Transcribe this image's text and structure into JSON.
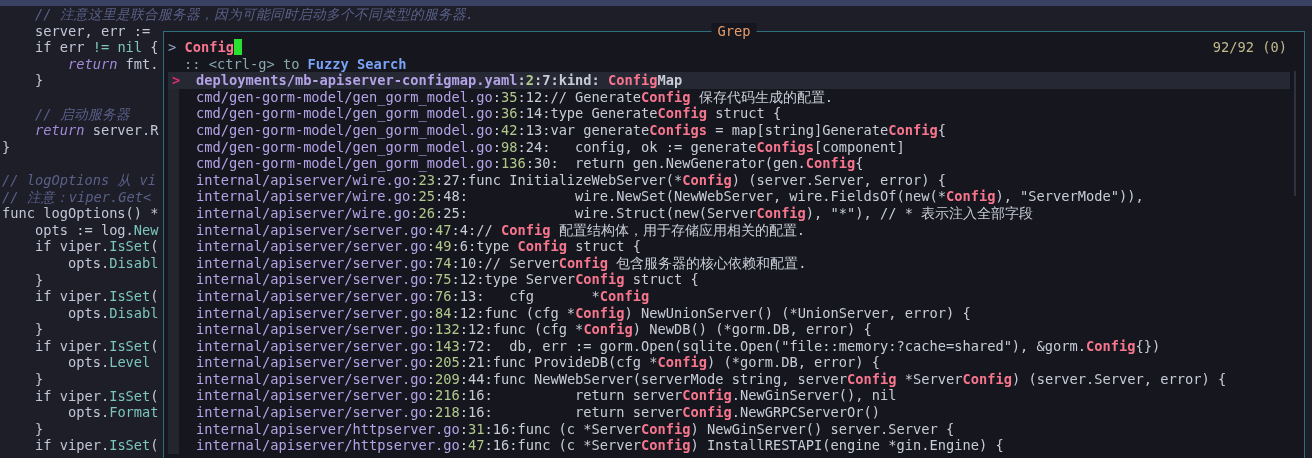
{
  "editor": {
    "code_blocks": [
      [
        {
          "segments": [
            {
              "kind": "comment",
              "text": "    // 注意这里是联合服务器，因为可能同时启动多个不同类型的服务器."
            }
          ]
        },
        {
          "segments": [
            {
              "kind": "text",
              "text": "    server, err :="
            }
          ]
        },
        {
          "segments": [
            {
              "kind": "text",
              "text": "    if err "
            },
            {
              "kind": "member",
              "text": "!= nil"
            },
            {
              "kind": "text",
              "text": " {"
            }
          ]
        },
        {
          "segments": [
            {
              "kind": "keyword",
              "text": "        return"
            },
            {
              "kind": "text",
              "text": " fmt."
            }
          ]
        },
        {
          "segments": [
            {
              "kind": "text",
              "text": "    }"
            }
          ]
        }
      ],
      [
        {
          "segments": [
            {
              "kind": "comment",
              "text": "    // 启动服务器"
            }
          ]
        },
        {
          "segments": [
            {
              "kind": "keyword",
              "text": "    return"
            },
            {
              "kind": "text",
              "text": " server.R"
            }
          ]
        },
        {
          "segments": [
            {
              "kind": "text",
              "text": "}"
            }
          ]
        }
      ],
      [
        {
          "segments": [
            {
              "kind": "comment",
              "text": "// logOptions 从 vi"
            }
          ]
        },
        {
          "segments": [
            {
              "kind": "comment",
              "text": "// 注意：viper.Get<"
            }
          ]
        },
        {
          "segments": [
            {
              "kind": "text",
              "text": "func logOptions() *"
            }
          ]
        },
        {
          "segments": [
            {
              "kind": "text",
              "text": "    opts := log."
            },
            {
              "kind": "member",
              "text": "New"
            }
          ]
        },
        {
          "segments": [
            {
              "kind": "text",
              "text": "    if viper."
            },
            {
              "kind": "member",
              "text": "IsSet"
            },
            {
              "kind": "text",
              "text": "("
            }
          ]
        },
        {
          "segments": [
            {
              "kind": "text",
              "text": "        opts."
            },
            {
              "kind": "member",
              "text": "Disabl"
            }
          ]
        },
        {
          "segments": [
            {
              "kind": "text",
              "text": "    }"
            }
          ]
        },
        {
          "segments": [
            {
              "kind": "text",
              "text": "    if viper."
            },
            {
              "kind": "member",
              "text": "IsSet"
            },
            {
              "kind": "text",
              "text": "("
            }
          ]
        },
        {
          "segments": [
            {
              "kind": "text",
              "text": "        opts."
            },
            {
              "kind": "member",
              "text": "Disabl"
            }
          ]
        },
        {
          "segments": [
            {
              "kind": "text",
              "text": "    }"
            }
          ]
        },
        {
          "segments": [
            {
              "kind": "text",
              "text": "    if viper."
            },
            {
              "kind": "member",
              "text": "IsSet"
            },
            {
              "kind": "text",
              "text": "("
            }
          ]
        },
        {
          "segments": [
            {
              "kind": "text",
              "text": "        opts."
            },
            {
              "kind": "member",
              "text": "Level"
            }
          ]
        },
        {
          "segments": [
            {
              "kind": "text",
              "text": "    }"
            }
          ]
        },
        {
          "segments": [
            {
              "kind": "text",
              "text": "    if viper."
            },
            {
              "kind": "member",
              "text": "IsSet"
            },
            {
              "kind": "text",
              "text": "("
            }
          ]
        },
        {
          "segments": [
            {
              "kind": "text",
              "text": "        opts."
            },
            {
              "kind": "member",
              "text": "Format"
            }
          ]
        },
        {
          "segments": [
            {
              "kind": "text",
              "text": "    }"
            }
          ]
        },
        {
          "segments": [
            {
              "kind": "text",
              "text": "    if viper."
            },
            {
              "kind": "member",
              "text": "IsSet"
            },
            {
              "kind": "text",
              "text": "("
            }
          ]
        }
      ]
    ]
  },
  "popup": {
    "title": "Grep",
    "prompt": {
      "symbol": ">",
      "query": "Config"
    },
    "counter": "92/92 (0)",
    "hint": ":: <ctrl-g> to **Fuzzy Search**",
    "selection_marker": ">",
    "results": [
      {
        "selected": true,
        "location": "deployments/mb-apiserver-configmap.yaml:2:7:",
        "segments": [
          {
            "text": "kind: ",
            "match": false
          },
          {
            "text": "Config",
            "match": true
          },
          {
            "text": "Map",
            "match": false
          }
        ]
      },
      {
        "selected": false,
        "location": "cmd/gen-gorm-model/gen_gorm_model.go:35:12:",
        "segments": [
          {
            "text": "// Generate",
            "match": false
          },
          {
            "text": "Config",
            "match": true
          },
          {
            "text": " 保存代码生成的配置.",
            "match": false
          }
        ]
      },
      {
        "selected": false,
        "location": "cmd/gen-gorm-model/gen_gorm_model.go:36:14:",
        "segments": [
          {
            "text": "type Generate",
            "match": false
          },
          {
            "text": "Config",
            "match": true
          },
          {
            "text": " struct {",
            "match": false
          }
        ]
      },
      {
        "selected": false,
        "location": "cmd/gen-gorm-model/gen_gorm_model.go:42:13:",
        "segments": [
          {
            "text": "var generate",
            "match": false
          },
          {
            "text": "Configs",
            "match": true
          },
          {
            "text": " = map[string]Generate",
            "match": false
          },
          {
            "text": "Config",
            "match": true
          },
          {
            "text": "{",
            "match": false
          }
        ]
      },
      {
        "selected": false,
        "location": "cmd/gen-gorm-model/gen_gorm_model.go:98:24:",
        "segments": [
          {
            "text": "   config, ok := generate",
            "match": false
          },
          {
            "text": "Configs",
            "match": true
          },
          {
            "text": "[component]",
            "match": false
          }
        ]
      },
      {
        "selected": false,
        "location": "cmd/gen-gorm-model/gen_gorm_model.go:136:30:",
        "segments": [
          {
            "text": "  return gen.NewGenerator(gen.",
            "match": false
          },
          {
            "text": "Config",
            "match": true
          },
          {
            "text": "{",
            "match": false
          }
        ]
      },
      {
        "selected": false,
        "location": "internal/apiserver/wire.go:23:27:",
        "segments": [
          {
            "text": "func InitializeWebServer(*",
            "match": false
          },
          {
            "text": "Config",
            "match": true
          },
          {
            "text": ") (server.Server, error) {",
            "match": false
          }
        ]
      },
      {
        "selected": false,
        "location": "internal/apiserver/wire.go:25:48:",
        "segments": [
          {
            "text": "             wire.NewSet(NewWebServer, wire.FieldsOf(new(*",
            "match": false
          },
          {
            "text": "Config",
            "match": true
          },
          {
            "text": "), \"ServerMode\")),",
            "match": false
          }
        ]
      },
      {
        "selected": false,
        "location": "internal/apiserver/wire.go:26:25:",
        "segments": [
          {
            "text": "             wire.Struct(new(Server",
            "match": false
          },
          {
            "text": "Config",
            "match": true
          },
          {
            "text": "), \"*\"), // * 表示注入全部字段",
            "match": false
          }
        ]
      },
      {
        "selected": false,
        "location": "internal/apiserver/server.go:47:4:",
        "segments": [
          {
            "text": "// ",
            "match": false
          },
          {
            "text": "Config",
            "match": true
          },
          {
            "text": " 配置结构体，用于存储应用相关的配置.",
            "match": false
          }
        ]
      },
      {
        "selected": false,
        "location": "internal/apiserver/server.go:49:6:",
        "segments": [
          {
            "text": "type ",
            "match": false
          },
          {
            "text": "Config",
            "match": true
          },
          {
            "text": " struct {",
            "match": false
          }
        ]
      },
      {
        "selected": false,
        "location": "internal/apiserver/server.go:74:10:",
        "segments": [
          {
            "text": "// Server",
            "match": false
          },
          {
            "text": "Config",
            "match": true
          },
          {
            "text": " 包含服务器的核心依赖和配置.",
            "match": false
          }
        ]
      },
      {
        "selected": false,
        "location": "internal/apiserver/server.go:75:12:",
        "segments": [
          {
            "text": "type Server",
            "match": false
          },
          {
            "text": "Config",
            "match": true
          },
          {
            "text": " struct {",
            "match": false
          }
        ]
      },
      {
        "selected": false,
        "location": "internal/apiserver/server.go:76:13:",
        "segments": [
          {
            "text": "   cfg       *",
            "match": false
          },
          {
            "text": "Config",
            "match": true
          }
        ]
      },
      {
        "selected": false,
        "location": "internal/apiserver/server.go:84:12:",
        "segments": [
          {
            "text": "func (cfg *",
            "match": false
          },
          {
            "text": "Config",
            "match": true
          },
          {
            "text": ") NewUnionServer() (*UnionServer, error) {",
            "match": false
          }
        ]
      },
      {
        "selected": false,
        "location": "internal/apiserver/server.go:132:12:",
        "segments": [
          {
            "text": "func (cfg *",
            "match": false
          },
          {
            "text": "Config",
            "match": true
          },
          {
            "text": ") NewDB() (*gorm.DB, error) {",
            "match": false
          }
        ]
      },
      {
        "selected": false,
        "location": "internal/apiserver/server.go:143:72:",
        "segments": [
          {
            "text": "  db, err := gorm.Open(sqlite.Open(\"file::memory:?cache=shared\"), &gorm.",
            "match": false
          },
          {
            "text": "Config",
            "match": true
          },
          {
            "text": "{})",
            "match": false
          }
        ]
      },
      {
        "selected": false,
        "location": "internal/apiserver/server.go:205:21:",
        "segments": [
          {
            "text": "func ProvideDB(cfg *",
            "match": false
          },
          {
            "text": "Config",
            "match": true
          },
          {
            "text": ") (*gorm.DB, error) {",
            "match": false
          }
        ]
      },
      {
        "selected": false,
        "location": "internal/apiserver/server.go:209:44:",
        "segments": [
          {
            "text": "func NewWebServer(serverMode string, server",
            "match": false
          },
          {
            "text": "Config",
            "match": true
          },
          {
            "text": " *Server",
            "match": false
          },
          {
            "text": "Config",
            "match": true
          },
          {
            "text": ") (server.Server, error) {",
            "match": false
          }
        ]
      },
      {
        "selected": false,
        "location": "internal/apiserver/server.go:216:16:",
        "segments": [
          {
            "text": "          return server",
            "match": false
          },
          {
            "text": "Config",
            "match": true
          },
          {
            "text": ".NewGinServer(), nil",
            "match": false
          }
        ]
      },
      {
        "selected": false,
        "location": "internal/apiserver/server.go:218:16:",
        "segments": [
          {
            "text": "          return server",
            "match": false
          },
          {
            "text": "Config",
            "match": true
          },
          {
            "text": ".NewGRPCServerOr()",
            "match": false
          }
        ]
      },
      {
        "selected": false,
        "location": "internal/apiserver/httpserver.go:31:16:",
        "segments": [
          {
            "text": "func (c *Server",
            "match": false
          },
          {
            "text": "Config",
            "match": true
          },
          {
            "text": ") NewGinServer() server.Server {",
            "match": false
          }
        ]
      },
      {
        "selected": false,
        "location": "internal/apiserver/httpserver.go:47:16:",
        "segments": [
          {
            "text": "func (c *Server",
            "match": false
          },
          {
            "text": "Config",
            "match": true
          },
          {
            "text": ") InstallRESTAPI(engine *gin.Engine) {",
            "match": false
          }
        ]
      }
    ]
  }
}
